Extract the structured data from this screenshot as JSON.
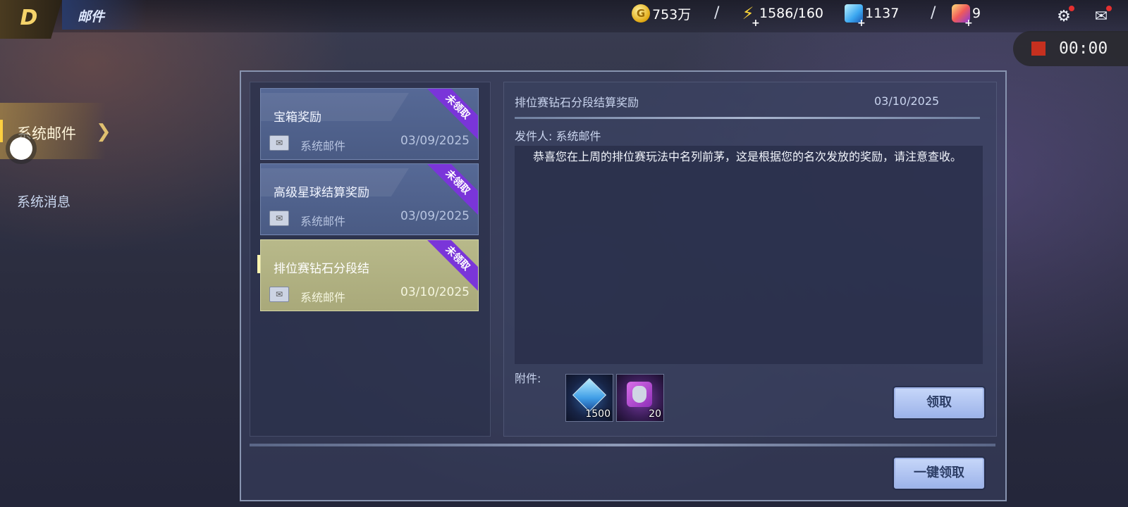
{
  "header": {
    "title": "邮件",
    "logo_glyph": "D"
  },
  "resources": {
    "gold": "753万",
    "energy": "1586/160",
    "diamond": "1137",
    "crystal": "9",
    "separator": "/"
  },
  "recorder": {
    "time": "00:00"
  },
  "sidebar": {
    "items": [
      {
        "label": "系统邮件",
        "active": true
      },
      {
        "label": "系统消息",
        "active": false
      }
    ]
  },
  "mail_list": {
    "items": [
      {
        "title": "宝箱奖励",
        "sender": "系统邮件",
        "date": "03/09/2025",
        "badge": "未领取"
      },
      {
        "title": "高级星球结算奖励",
        "sender": "系统邮件",
        "date": "03/09/2025",
        "badge": "未领取"
      },
      {
        "title": "排位赛钻石分段结",
        "sender": "系统邮件",
        "date": "03/10/2025",
        "badge": "未领取"
      }
    ]
  },
  "detail": {
    "title": "排位赛钻石分段结算奖励",
    "date": "03/10/2025",
    "sender_line": "发件人:  系统邮件",
    "body": "恭喜您在上周的排位赛玩法中名列前茅，这是根据您的名次发放的奖励，请注意查收。",
    "attachments_label": "附件:",
    "attachments": [
      {
        "icon": "diamond-crystal",
        "quantity": "1500"
      },
      {
        "icon": "hero-puzzle-piece",
        "quantity": "20"
      }
    ],
    "claim_label": "领取"
  },
  "claim_all_label": "一键领取",
  "colors": {
    "badge": "#7a35d9",
    "selected_mail": "#b8b98a",
    "button": "#c6d6f9",
    "accent_gold": "#ffd040"
  }
}
